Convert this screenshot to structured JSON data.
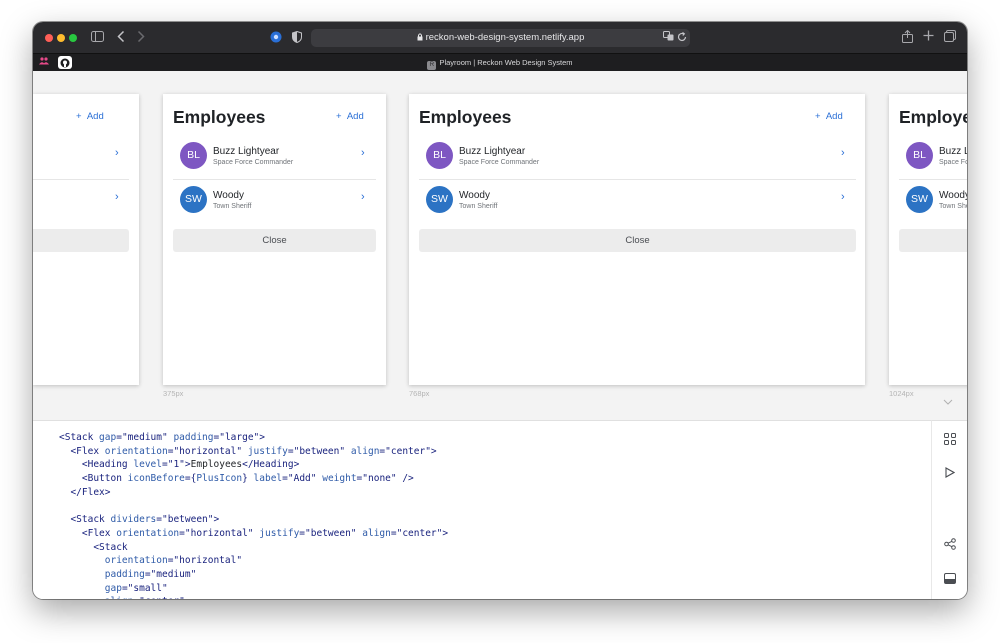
{
  "browser": {
    "url": "reckon-web-design-system.netlify.app",
    "tab_title": "Playroom | Reckon Web Design System",
    "tab_favicon": "R",
    "icons": [
      "sidebar-icon",
      "back-icon",
      "forward-icon",
      "extension-icon",
      "shield-icon",
      "lock-icon",
      "translate-icon",
      "reload-icon",
      "share-icon",
      "new-tab-icon",
      "tabs-overview-icon"
    ]
  },
  "preview": {
    "heading": "Employees",
    "add_label": "Add",
    "close_label": "Close",
    "employees": [
      {
        "initials": "BL",
        "name": "Buzz Lightyear",
        "role": "Space Force Commander",
        "avatar_color": "#7e57c2"
      },
      {
        "initials": "SW",
        "name": "Woody",
        "role": "Town Sheriff",
        "avatar_color": "#2c73c4"
      }
    ],
    "frames": [
      {
        "label": ""
      },
      {
        "label": "375px"
      },
      {
        "label": "768px"
      },
      {
        "label": "1024px"
      }
    ]
  },
  "editor": {
    "lines": [
      [
        [
          "tag",
          "<Stack "
        ],
        [
          "attr",
          "gap"
        ],
        [
          "tag",
          "="
        ],
        [
          "str",
          "\"medium\""
        ],
        [
          "tag",
          " "
        ],
        [
          "attr",
          "padding"
        ],
        [
          "tag",
          "="
        ],
        [
          "str",
          "\"large\""
        ],
        [
          "tag",
          ">"
        ]
      ],
      [
        [
          "text",
          "  "
        ],
        [
          "tag",
          "<Flex "
        ],
        [
          "attr",
          "orientation"
        ],
        [
          "tag",
          "="
        ],
        [
          "str",
          "\"horizontal\""
        ],
        [
          "tag",
          " "
        ],
        [
          "attr",
          "justify"
        ],
        [
          "tag",
          "="
        ],
        [
          "str",
          "\"between\""
        ],
        [
          "tag",
          " "
        ],
        [
          "attr",
          "align"
        ],
        [
          "tag",
          "="
        ],
        [
          "str",
          "\"center\""
        ],
        [
          "tag",
          ">"
        ]
      ],
      [
        [
          "text",
          "    "
        ],
        [
          "tag",
          "<Heading "
        ],
        [
          "attr",
          "level"
        ],
        [
          "tag",
          "="
        ],
        [
          "str",
          "\"1\""
        ],
        [
          "tag",
          ">"
        ],
        [
          "text",
          "Employees"
        ],
        [
          "tag",
          "</Heading>"
        ]
      ],
      [
        [
          "text",
          "    "
        ],
        [
          "tag",
          "<Button "
        ],
        [
          "attr",
          "iconBefore"
        ],
        [
          "tag",
          "={"
        ],
        [
          "attr",
          "PlusIcon"
        ],
        [
          "tag",
          "} "
        ],
        [
          "attr",
          "label"
        ],
        [
          "tag",
          "="
        ],
        [
          "str",
          "\"Add\""
        ],
        [
          "tag",
          " "
        ],
        [
          "attr",
          "weight"
        ],
        [
          "tag",
          "="
        ],
        [
          "str",
          "\"none\""
        ],
        [
          "tag",
          " />"
        ]
      ],
      [
        [
          "text",
          "  "
        ],
        [
          "tag",
          "</Flex>"
        ]
      ],
      [
        [
          "text",
          ""
        ]
      ],
      [
        [
          "text",
          "  "
        ],
        [
          "tag",
          "<Stack "
        ],
        [
          "attr",
          "dividers"
        ],
        [
          "tag",
          "="
        ],
        [
          "str",
          "\"between\""
        ],
        [
          "tag",
          ">"
        ]
      ],
      [
        [
          "text",
          "    "
        ],
        [
          "tag",
          "<Flex "
        ],
        [
          "attr",
          "orientation"
        ],
        [
          "tag",
          "="
        ],
        [
          "str",
          "\"horizontal\""
        ],
        [
          "tag",
          " "
        ],
        [
          "attr",
          "justify"
        ],
        [
          "tag",
          "="
        ],
        [
          "str",
          "\"between\""
        ],
        [
          "tag",
          " "
        ],
        [
          "attr",
          "align"
        ],
        [
          "tag",
          "="
        ],
        [
          "str",
          "\"center\""
        ],
        [
          "tag",
          ">"
        ]
      ],
      [
        [
          "text",
          "      "
        ],
        [
          "tag",
          "<Stack"
        ]
      ],
      [
        [
          "text",
          "        "
        ],
        [
          "attr",
          "orientation"
        ],
        [
          "tag",
          "="
        ],
        [
          "str",
          "\"horizontal\""
        ]
      ],
      [
        [
          "text",
          "        "
        ],
        [
          "attr",
          "padding"
        ],
        [
          "tag",
          "="
        ],
        [
          "str",
          "\"medium\""
        ]
      ],
      [
        [
          "text",
          "        "
        ],
        [
          "attr",
          "gap"
        ],
        [
          "tag",
          "="
        ],
        [
          "str",
          "\"small\""
        ]
      ],
      [
        [
          "text",
          "        "
        ],
        [
          "attr",
          "align"
        ],
        [
          "tag",
          "="
        ],
        [
          "str",
          "\"center\""
        ]
      ]
    ]
  },
  "toolbar": {
    "tools": [
      "snippets-icon",
      "play-icon",
      "share-icon",
      "panel-toggle-icon"
    ]
  }
}
